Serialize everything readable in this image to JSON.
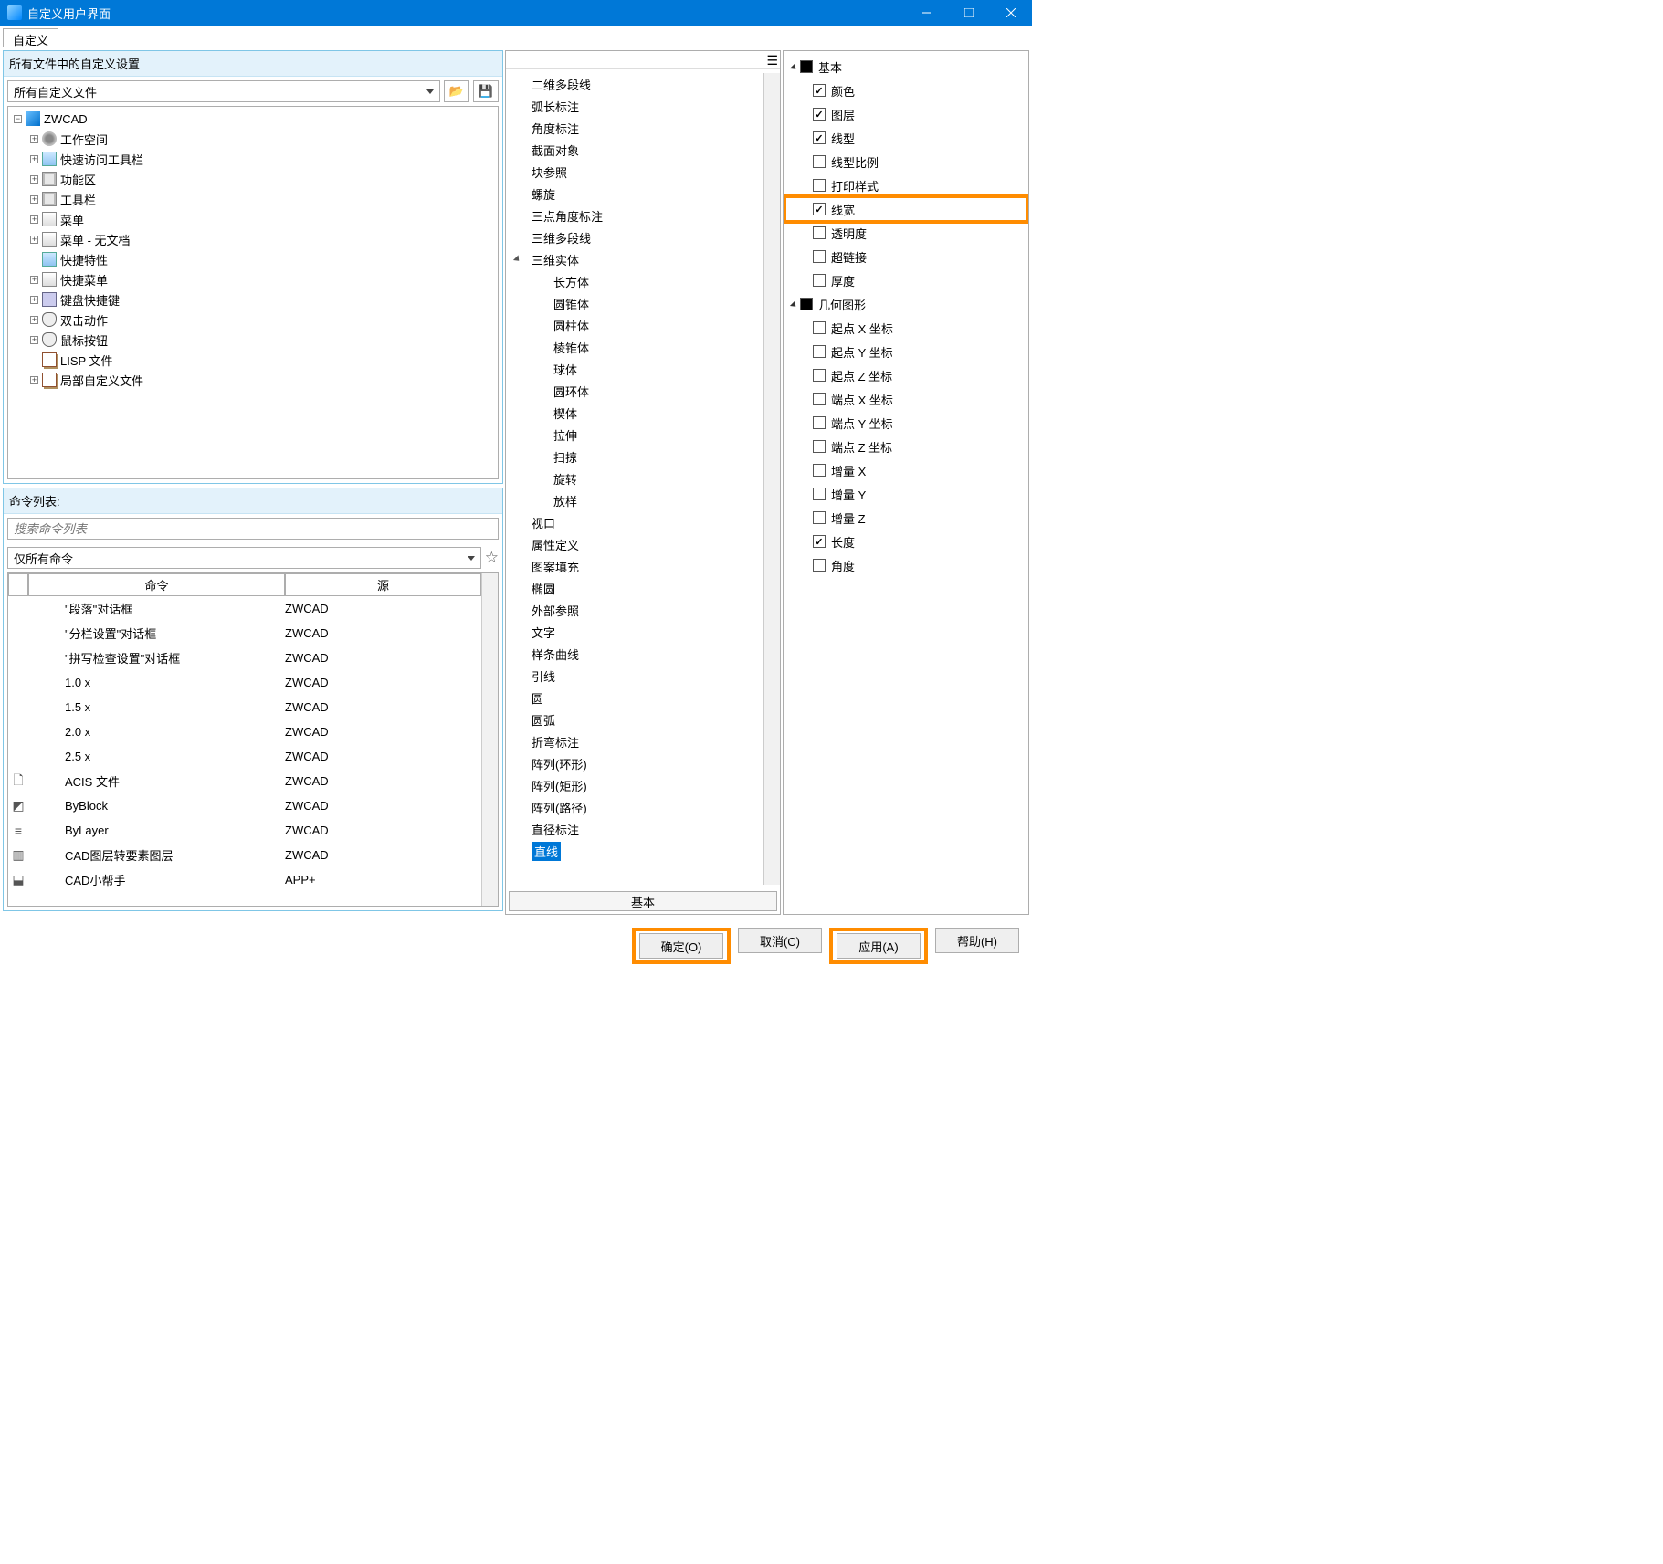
{
  "title": "自定义用户界面",
  "tab": "自定义",
  "group1_title": "所有文件中的自定义设置",
  "filter1": "所有自定义文件",
  "tree_root": "ZWCAD",
  "tree_items": [
    {
      "label": "工作空间",
      "exp": "+",
      "icon": "gear"
    },
    {
      "label": "快速访问工具栏",
      "exp": "+",
      "icon": "box"
    },
    {
      "label": "功能区",
      "exp": "+",
      "icon": "panel"
    },
    {
      "label": "工具栏",
      "exp": "+",
      "icon": "panel"
    },
    {
      "label": "菜单",
      "exp": "+",
      "icon": "menu"
    },
    {
      "label": "菜单 - 无文档",
      "exp": "+",
      "icon": "menu"
    },
    {
      "label": "快捷特性",
      "exp": "",
      "icon": "box"
    },
    {
      "label": "快捷菜单",
      "exp": "+",
      "icon": "menu"
    },
    {
      "label": "键盘快捷键",
      "exp": "+",
      "icon": "kb"
    },
    {
      "label": "双击动作",
      "exp": "+",
      "icon": "mouse"
    },
    {
      "label": "鼠标按钮",
      "exp": "+",
      "icon": "mouse"
    },
    {
      "label": "LISP  文件",
      "exp": "",
      "icon": "docs"
    },
    {
      "label": "局部自定义文件",
      "exp": "+",
      "icon": "docs"
    }
  ],
  "group2_title": "命令列表:",
  "search_placeholder": "搜索命令列表",
  "filter2": "仅所有命令",
  "th1": "命令",
  "th2": "源",
  "cmds": [
    {
      "cmd": "\"段落\"对话框",
      "src": "ZWCAD",
      "icon": ""
    },
    {
      "cmd": "\"分栏设置\"对话框",
      "src": "ZWCAD",
      "icon": ""
    },
    {
      "cmd": "\"拼写检查设置\"对话框",
      "src": "ZWCAD",
      "icon": ""
    },
    {
      "cmd": "1.0 x",
      "src": "ZWCAD",
      "icon": ""
    },
    {
      "cmd": "1.5 x",
      "src": "ZWCAD",
      "icon": ""
    },
    {
      "cmd": "2.0 x",
      "src": "ZWCAD",
      "icon": ""
    },
    {
      "cmd": "2.5 x",
      "src": "ZWCAD",
      "icon": ""
    },
    {
      "cmd": "ACIS 文件",
      "src": "ZWCAD",
      "icon": "🗋"
    },
    {
      "cmd": "ByBlock",
      "src": "ZWCAD",
      "icon": "◩"
    },
    {
      "cmd": "ByLayer",
      "src": "ZWCAD",
      "icon": "≡"
    },
    {
      "cmd": "CAD图层转要素图层",
      "src": "ZWCAD",
      "icon": "▥"
    },
    {
      "cmd": "CAD小帮手",
      "src": "APP+",
      "icon": "⬓"
    }
  ],
  "mid_items": [
    {
      "label": "二维多段线",
      "l": 1
    },
    {
      "label": "弧长标注",
      "l": 1
    },
    {
      "label": "角度标注",
      "l": 1
    },
    {
      "label": "截面对象",
      "l": 1
    },
    {
      "label": "块参照",
      "l": 1
    },
    {
      "label": "螺旋",
      "l": 1
    },
    {
      "label": "三点角度标注",
      "l": 1
    },
    {
      "label": "三维多段线",
      "l": 1
    },
    {
      "label": "三维实体",
      "l": 1,
      "exp": true
    },
    {
      "label": "长方体",
      "l": 2
    },
    {
      "label": "圆锥体",
      "l": 2
    },
    {
      "label": "圆柱体",
      "l": 2
    },
    {
      "label": "棱锥体",
      "l": 2
    },
    {
      "label": "球体",
      "l": 2
    },
    {
      "label": "圆环体",
      "l": 2
    },
    {
      "label": "楔体",
      "l": 2
    },
    {
      "label": "拉伸",
      "l": 2
    },
    {
      "label": "扫掠",
      "l": 2
    },
    {
      "label": "旋转",
      "l": 2
    },
    {
      "label": "放样",
      "l": 2
    },
    {
      "label": "视口",
      "l": 1
    },
    {
      "label": "属性定义",
      "l": 1
    },
    {
      "label": "图案填充",
      "l": 1
    },
    {
      "label": "椭圆",
      "l": 1
    },
    {
      "label": "外部参照",
      "l": 1
    },
    {
      "label": "文字",
      "l": 1
    },
    {
      "label": "样条曲线",
      "l": 1
    },
    {
      "label": "引线",
      "l": 1
    },
    {
      "label": "圆",
      "l": 1
    },
    {
      "label": "圆弧",
      "l": 1
    },
    {
      "label": "折弯标注",
      "l": 1
    },
    {
      "label": "阵列(环形)",
      "l": 1
    },
    {
      "label": "阵列(矩形)",
      "l": 1
    },
    {
      "label": "阵列(路径)",
      "l": 1
    },
    {
      "label": "直径标注",
      "l": 1
    },
    {
      "label": "直线",
      "l": 1,
      "sel": true
    }
  ],
  "midtab": "基本",
  "rhead1": "基本",
  "rprops1": [
    {
      "label": "颜色",
      "chk": true
    },
    {
      "label": "图层",
      "chk": true
    },
    {
      "label": "线型",
      "chk": true
    },
    {
      "label": "线型比例",
      "chk": false
    },
    {
      "label": "打印样式",
      "chk": false
    },
    {
      "label": "线宽",
      "chk": true,
      "hl": true
    },
    {
      "label": "透明度",
      "chk": false
    },
    {
      "label": "超链接",
      "chk": false
    },
    {
      "label": "厚度",
      "chk": false
    }
  ],
  "rhead2": "几何图形",
  "rprops2": [
    {
      "label": "起点 X 坐标",
      "chk": false
    },
    {
      "label": "起点 Y 坐标",
      "chk": false
    },
    {
      "label": "起点 Z 坐标",
      "chk": false
    },
    {
      "label": "端点 X 坐标",
      "chk": false
    },
    {
      "label": "端点 Y 坐标",
      "chk": false
    },
    {
      "label": "端点 Z 坐标",
      "chk": false
    },
    {
      "label": "增量 X",
      "chk": false
    },
    {
      "label": "增量 Y",
      "chk": false
    },
    {
      "label": "增量 Z",
      "chk": false
    },
    {
      "label": "长度",
      "chk": true
    },
    {
      "label": "角度",
      "chk": false
    }
  ],
  "btn_ok": "确定(O)",
  "btn_cancel": "取消(C)",
  "btn_apply": "应用(A)",
  "btn_help": "帮助(H)"
}
